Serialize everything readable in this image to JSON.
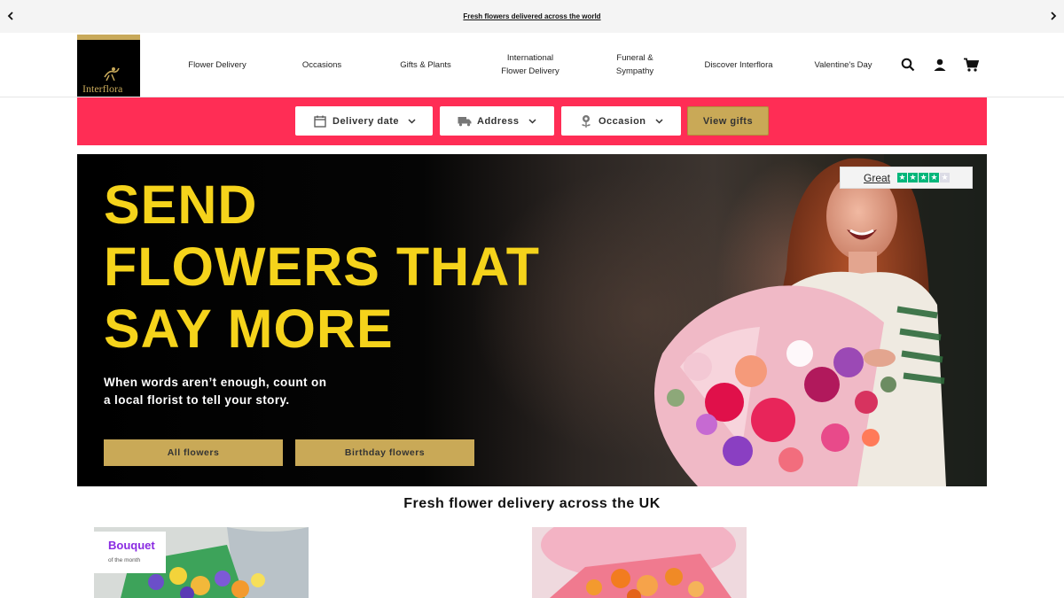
{
  "announcement": {
    "text": "Fresh flowers delivered across the world",
    "prev_icon": "chevron-left-icon",
    "next_icon": "chevron-right-icon"
  },
  "header": {
    "logo_text": "Interflora",
    "nav": [
      {
        "label": "Flower Delivery"
      },
      {
        "label": "Occasions"
      },
      {
        "label": "Gifts & Plants"
      },
      {
        "label": "International Flower Delivery"
      },
      {
        "label": "Funeral & Sympathy"
      },
      {
        "label": "Discover Interflora"
      },
      {
        "label": "Valentine's Day"
      }
    ],
    "icons": [
      "search-icon",
      "account-icon",
      "cart-icon"
    ]
  },
  "filters": {
    "delivery_date": "Delivery date",
    "address": "Address",
    "occasion": "Occasion",
    "view_gifts": "View gifts"
  },
  "hero": {
    "title_lines": [
      "SEND",
      "FLOWERS THAT",
      "SAY MORE"
    ],
    "subtitle": "When words aren’t enough, count on a local florist to tell your story.",
    "buttons": {
      "all": "All flowers",
      "birthday": "Birthday flowers"
    },
    "trust": {
      "label": "Great",
      "stars_filled": 4,
      "stars_total": 5
    }
  },
  "section": {
    "title": "Fresh flower delivery across the UK",
    "card_badge": {
      "title": "Bouquet",
      "subtitle": "of the month"
    }
  },
  "colors": {
    "accent_pink": "#ff2d55",
    "gold": "#c9a957",
    "hero_title": "#f5d31b",
    "trustpilot_green": "#00b67a",
    "badge_purple": "#8a2be2"
  }
}
